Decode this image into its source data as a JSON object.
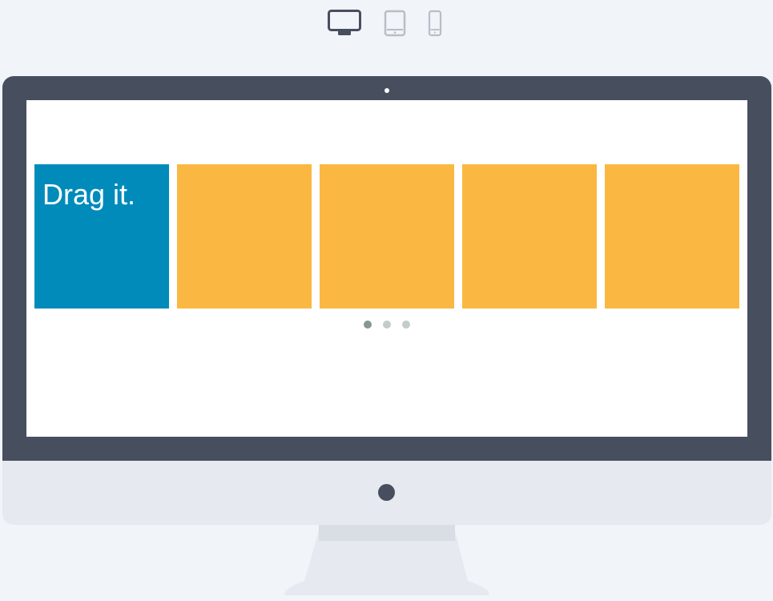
{
  "device_switcher": {
    "options": [
      {
        "icon": "desktop-icon",
        "active": true
      },
      {
        "icon": "tablet-icon",
        "active": false
      },
      {
        "icon": "mobile-icon",
        "active": false
      }
    ],
    "colors": {
      "active": "#474f5f",
      "inactive": "#b9bdc6"
    }
  },
  "carousel": {
    "slides": [
      {
        "title": "Drag it.",
        "color": "#008bbb"
      },
      {
        "title": "",
        "color": "#fab842"
      },
      {
        "title": "",
        "color": "#fab842"
      },
      {
        "title": "",
        "color": "#fab842"
      },
      {
        "title": "",
        "color": "#fab842"
      }
    ],
    "pagination": {
      "pages": 3,
      "current": 1
    }
  },
  "colors": {
    "background": "#f1f4f9",
    "bezel": "#474f5f",
    "chin": "#e6e9ef",
    "screen": "#ffffff"
  }
}
